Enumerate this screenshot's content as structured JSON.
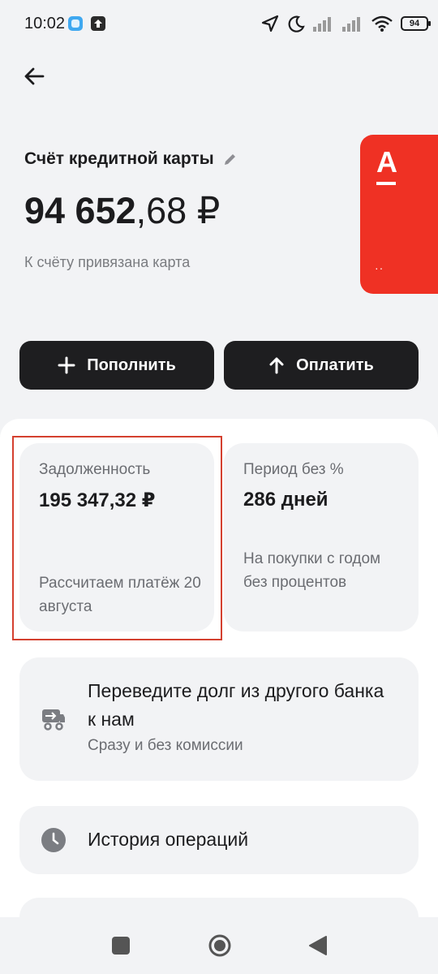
{
  "status_bar": {
    "time": "10:02",
    "battery": "94",
    "icons": [
      "app-notification-icon",
      "upload-icon",
      "location-arrow-icon",
      "moon-icon",
      "signal-icon",
      "signal-icon",
      "wifi-icon",
      "battery-icon"
    ]
  },
  "account": {
    "title": "Счёт кредитной карты",
    "balance_int": "94 652",
    "balance_frac": ",68 ₽",
    "card_linked": "К счёту привязана карта"
  },
  "card": {
    "logo": "А",
    "number": "··",
    "color": "#ef3124"
  },
  "actions": {
    "topup": "Пополнить",
    "pay": "Оплатить"
  },
  "debt_tile": {
    "label": "Задолженность",
    "value": "195 347,32 ₽",
    "note": "Рассчитаем платёж 20 августа"
  },
  "grace_tile": {
    "label": "Период без %",
    "value": "286 дней",
    "note": "На покупки с годом без процентов"
  },
  "transfer": {
    "title": "Переведите долг из другого банка к нам",
    "subtitle": "Сразу и без комиссии",
    "icon": "truck-icon"
  },
  "history": {
    "label": "История операций",
    "icon": "clock-icon"
  },
  "colors": {
    "background": "#f2f3f5",
    "button": "#1e1e20",
    "brand_red": "#ef3124",
    "highlight": "#d4402f"
  }
}
